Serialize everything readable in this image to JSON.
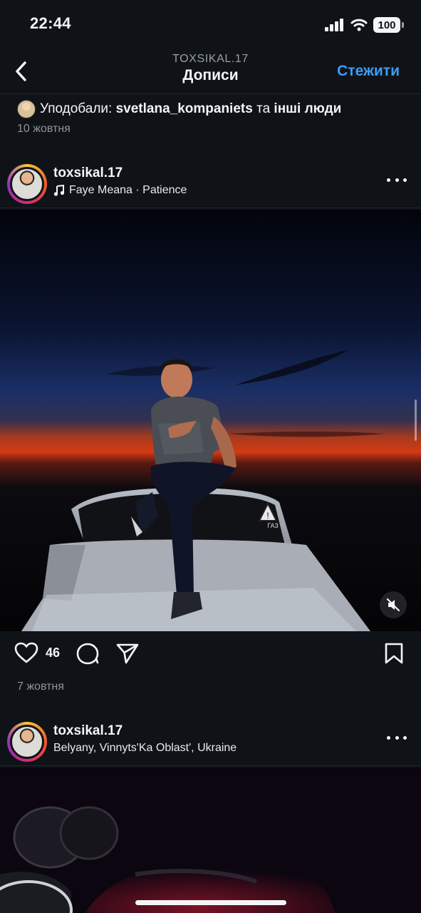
{
  "status_bar": {
    "time": "22:44",
    "battery": "100"
  },
  "header": {
    "subtitle": "TOXSIKAL.17",
    "title": "Дописи",
    "follow_label": "Стежити"
  },
  "liked_by": {
    "prefix": "Уподобали:",
    "username": "svetlana_kompaniets",
    "connector": "та",
    "others": "інші люди",
    "date": "10 жовтня"
  },
  "posts": [
    {
      "username": "toxsikal.17",
      "music": "Faye Meana · Patience",
      "likes": "46",
      "date": "7 жовтня"
    },
    {
      "username": "toxsikal.17",
      "location": "Belyany, Vinnyts'Ka Oblast', Ukraine"
    }
  ],
  "media_text": {
    "car_badge": "ГАЗ"
  },
  "icons": {
    "back": "chevron-left-icon",
    "music": "music-note-icon",
    "more": "more-horizontal-icon",
    "mute": "speaker-muted-icon",
    "like": "heart-icon",
    "comment": "comment-icon",
    "share": "send-icon",
    "save": "bookmark-icon"
  },
  "colors": {
    "background": "#0f1318",
    "accent": "#3d9df5",
    "muted_text": "#8e949b"
  }
}
